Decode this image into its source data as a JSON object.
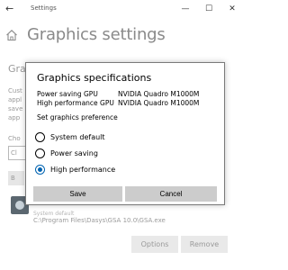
{
  "window": {
    "title": "Settings",
    "back_glyph": "←",
    "minimize_glyph": "—",
    "maximize_glyph": "☐",
    "close_glyph": "✕"
  },
  "page": {
    "title": "Graphics settings",
    "icon": "home-icon"
  },
  "background": {
    "heading": "Gra",
    "description_lines": [
      "Cust",
      "appl",
      "save",
      "app"
    ],
    "choose_label": "Cho",
    "select_value": "Cl",
    "browse_label": "B",
    "app_system_default": "System default",
    "app_path": "C:\\Program Files\\Dasys\\GSA 10.0\\GSA.exe",
    "options_button": "Options",
    "remove_button": "Remove"
  },
  "dialog": {
    "title": "Graphics specifications",
    "power_saving_label": "Power saving GPU",
    "power_saving_value": "NVIDIA Quadro M1000M",
    "high_perf_label": "High performance GPU",
    "high_perf_value": "NVIDIA Quadro M1000M",
    "preference_label": "Set graphics preference",
    "options": [
      {
        "label": "System default",
        "checked": false
      },
      {
        "label": "Power saving",
        "checked": false
      },
      {
        "label": "High performance",
        "checked": true
      }
    ],
    "save_label": "Save",
    "cancel_label": "Cancel"
  },
  "colors": {
    "accent": "#0063b1",
    "button_bg": "#cccccc",
    "faded_text": "#9a9a9a"
  }
}
